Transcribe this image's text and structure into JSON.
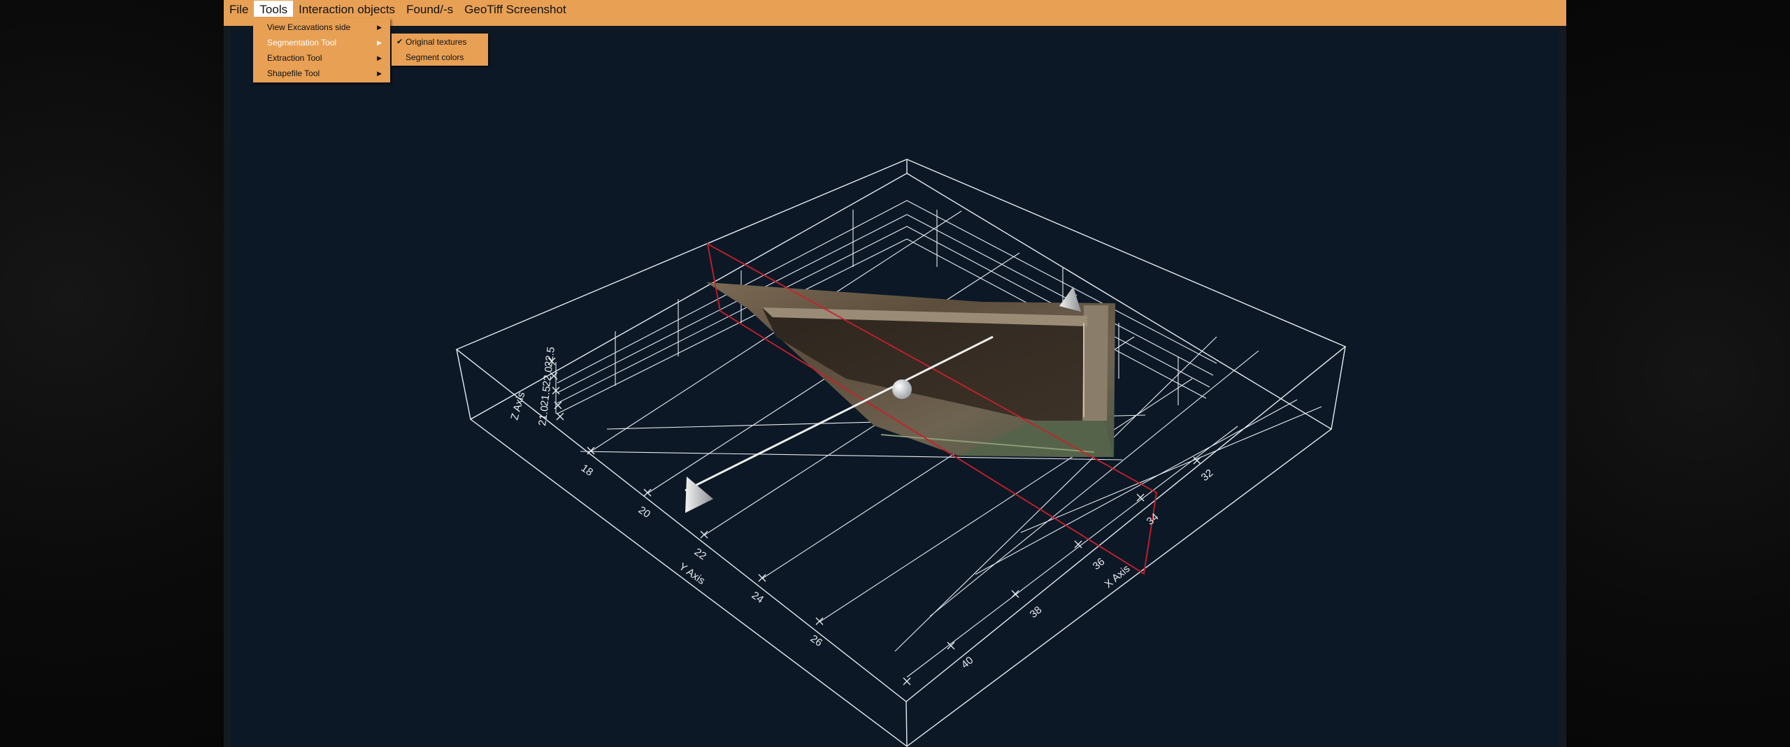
{
  "menubar": {
    "items": [
      "File",
      "Tools",
      "Interaction objects",
      "Found/-s",
      "GeoTiff Screenshot"
    ],
    "active_index": 1
  },
  "tools_menu": {
    "items": [
      {
        "label": "View Excavations side",
        "has_submenu": true
      },
      {
        "label": "Segmentation Tool",
        "has_submenu": true,
        "highlighted": true
      },
      {
        "label": "Extraction Tool",
        "has_submenu": true
      },
      {
        "label": "Shapefile Tool",
        "has_submenu": true
      }
    ]
  },
  "segmentation_submenu": {
    "items": [
      {
        "label": "Original textures",
        "checked": true
      },
      {
        "label": "Segment colors",
        "checked": false
      }
    ]
  },
  "scene": {
    "x_axis": {
      "label": "X Axis",
      "ticks": [
        "32",
        "34",
        "36",
        "38",
        "40"
      ]
    },
    "y_axis": {
      "label": "Y Axis",
      "ticks": [
        "18",
        "20",
        "22",
        "24",
        "26"
      ]
    },
    "z_axis": {
      "label": "Z Axis",
      "ticks": [
        "21.0",
        "21.5",
        "22.0",
        "22.5"
      ]
    }
  },
  "colors": {
    "menubar": "#e8a055",
    "viewport_bg": "#0d1826",
    "grid": "#e6ebf0",
    "cut_plane": "#c8202a"
  }
}
